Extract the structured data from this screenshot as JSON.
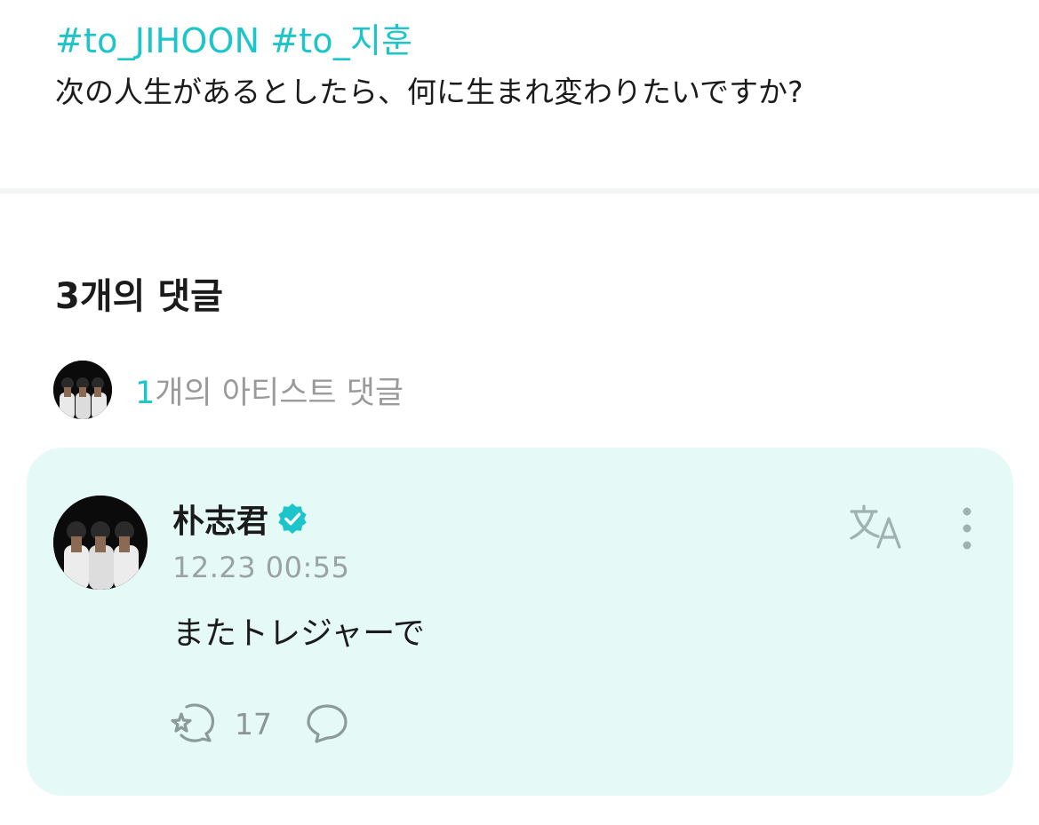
{
  "post": {
    "hashtags": [
      "#to_JIHOON",
      "#to_지훈"
    ],
    "question": "次の人生があるとしたら、何に生まれ変わりたいですか?"
  },
  "comments": {
    "title": "3개의 댓글",
    "artist_filter": {
      "count": "1",
      "label": "개의 아티스트 댓글"
    }
  },
  "comment": {
    "author": "朴志君",
    "verified_icon": "verified-badge-icon",
    "timestamp": "12.23 00:55",
    "text": "またトレジャーで",
    "likes": "17",
    "translate_icon": "translate-icon",
    "more_icon": "more-vertical-icon",
    "like_icon": "like-icon",
    "reply_icon": "reply-bubble-icon"
  },
  "colors": {
    "accent": "#1cc5c9",
    "card_bg": "#e5faf7",
    "muted": "#9aa2a2"
  }
}
